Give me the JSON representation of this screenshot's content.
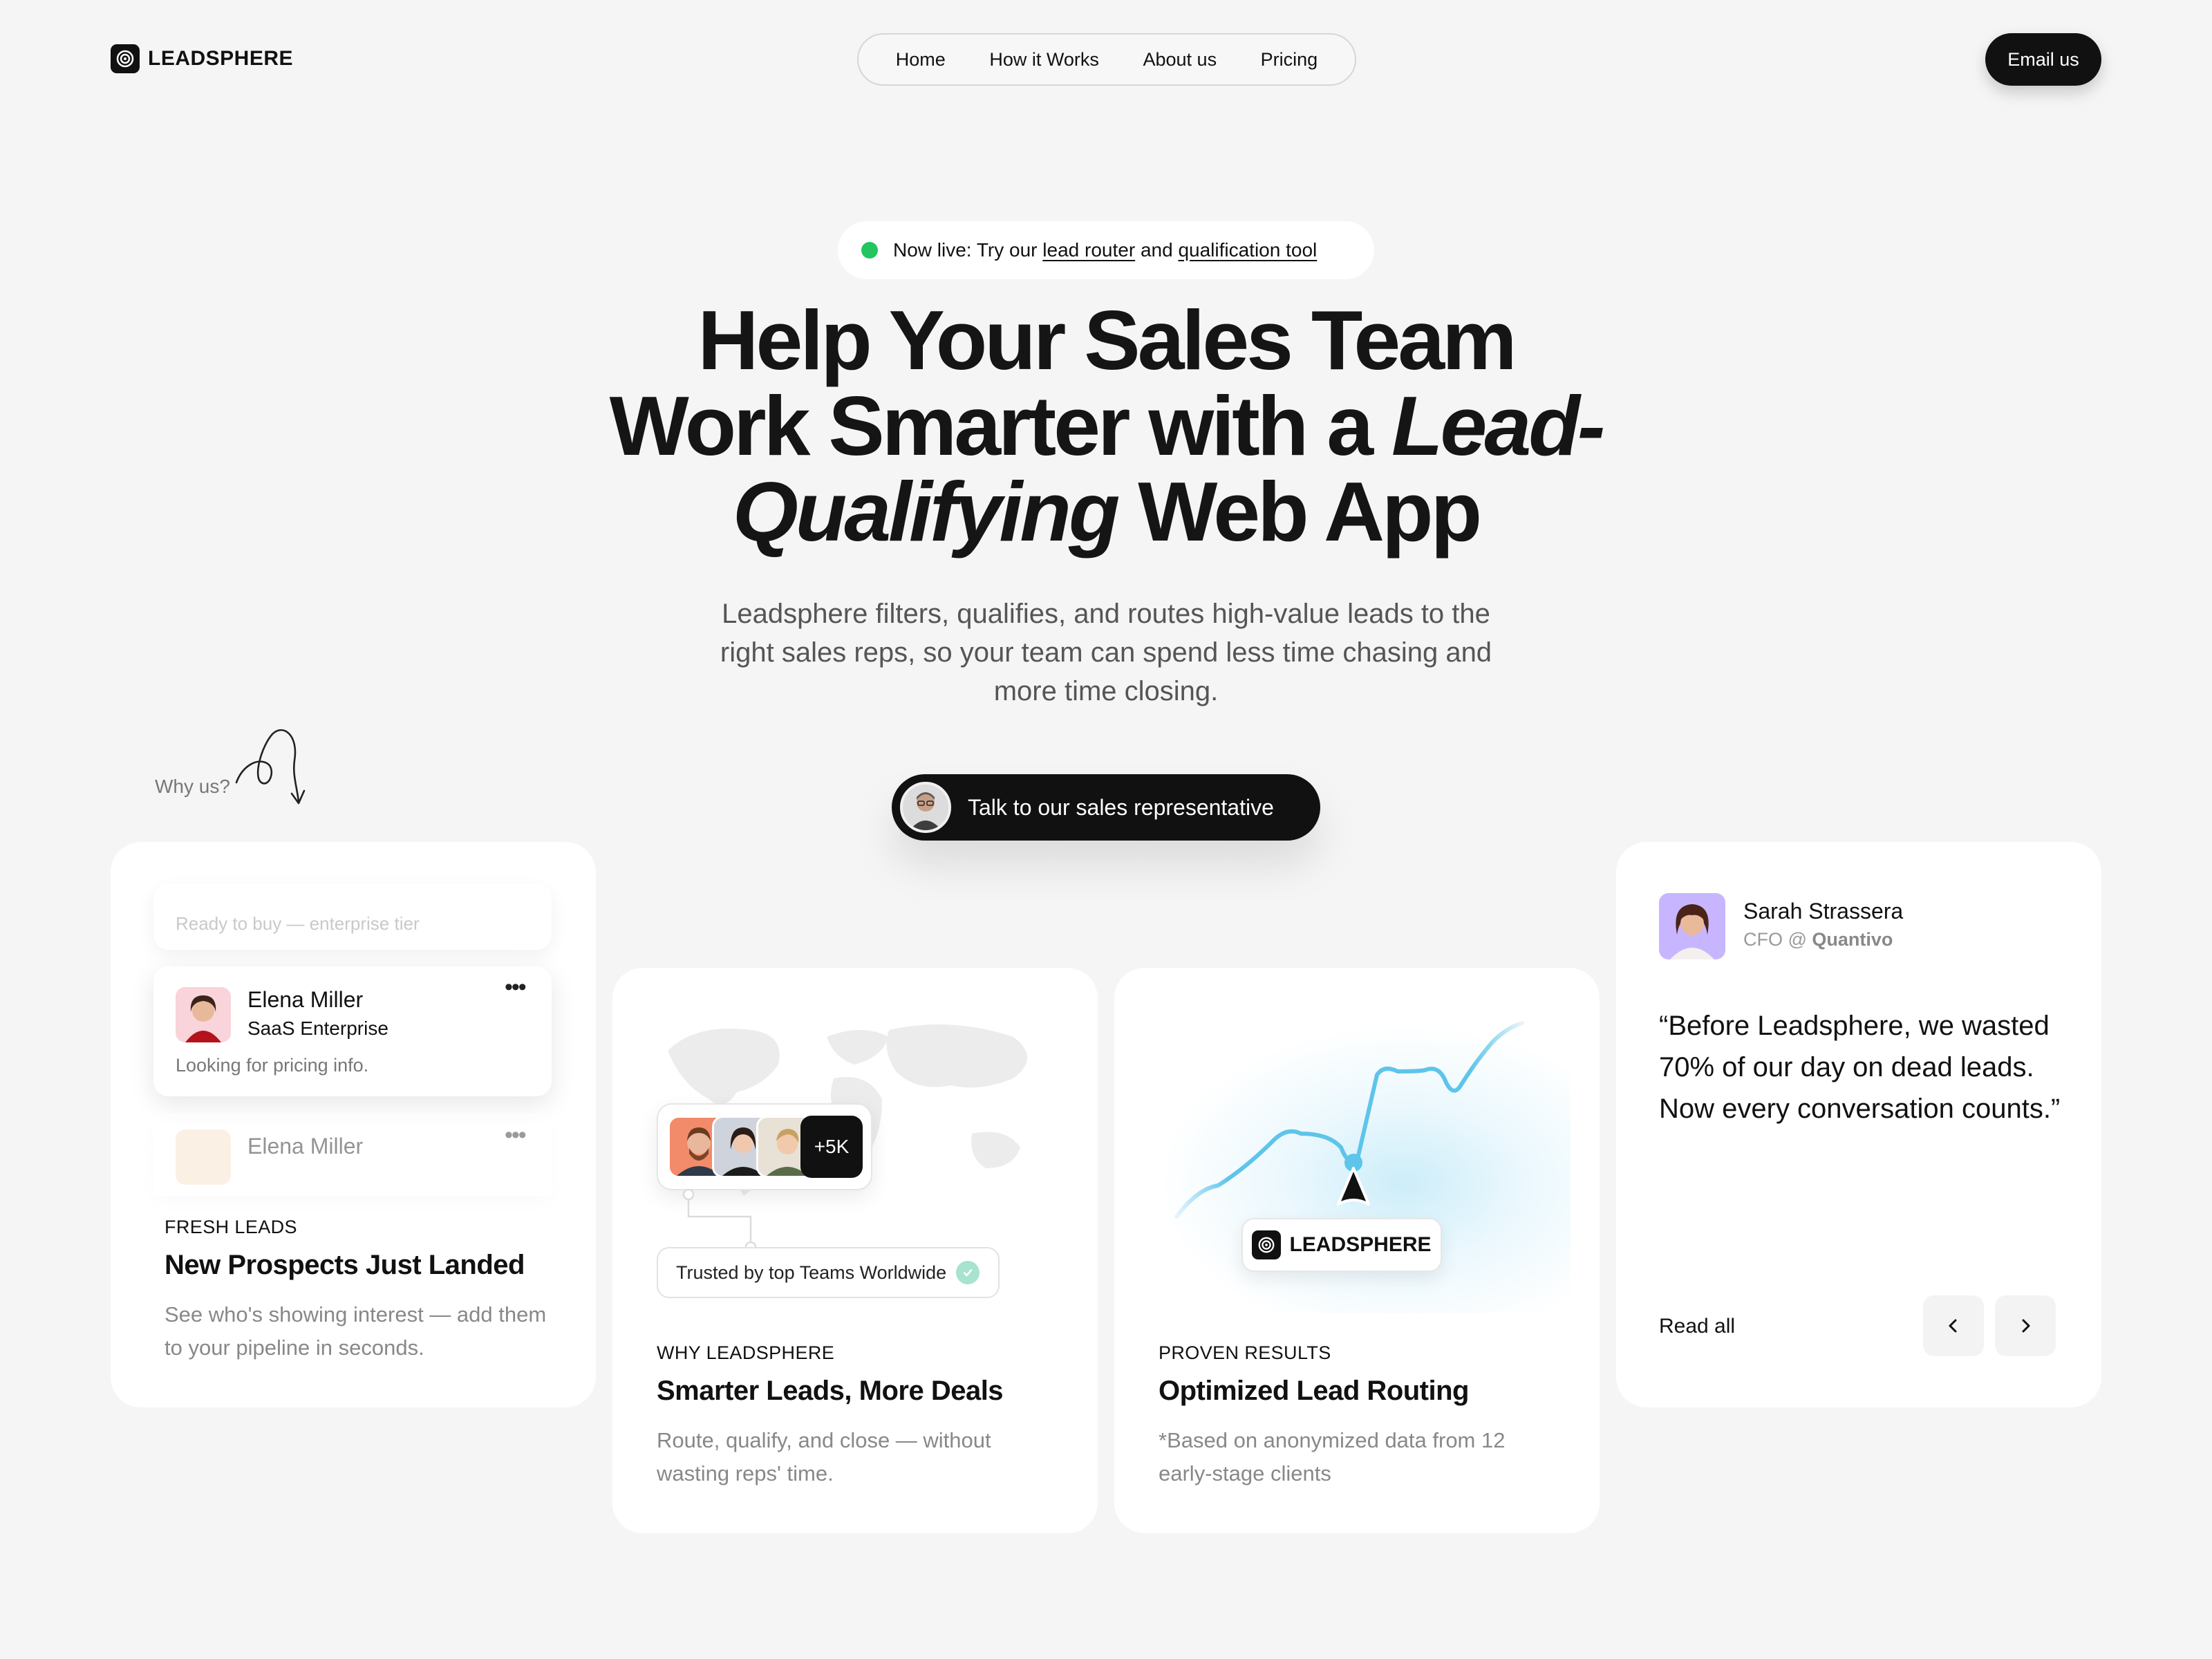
{
  "brand": {
    "name": "LEADSPHERE"
  },
  "nav": {
    "items": [
      "Home",
      "How it Works",
      "About us",
      "Pricing"
    ]
  },
  "header": {
    "email_label": "Email us"
  },
  "hero": {
    "live_prefix": "Now live: Try our",
    "live_link1": "lead router",
    "live_and": "and",
    "live_link2": "qualification tool",
    "title_line1": "Help Your Sales Team",
    "title_line2_a": "Work Smarter with a ",
    "title_line2_b": "Lead-",
    "title_line3_a": "Qualifying",
    "title_line3_b": " Web App",
    "subtitle": "Leadsphere filters, qualifies, and routes high-value leads to the right sales reps, so your team can spend less time chasing and more time closing.",
    "cta_label": "Talk to our sales representative",
    "why_us": "Why us?"
  },
  "cards": {
    "fresh": {
      "ghost_text": "Ready to buy — enterprise tier",
      "lead_name": "Elena Miller",
      "lead_company": "SaaS Enterprise",
      "lead_note": "Looking for pricing info.",
      "faded_name": "Elena Miller",
      "eyebrow": "FRESH LEADS",
      "title": "New Prospects Just Landed",
      "desc": "See who's showing interest — add them to your pipeline in seconds."
    },
    "why": {
      "more_count": "+5K",
      "trusted": "Trusted by top Teams Worldwide",
      "eyebrow": "WHY LEADSPHERE",
      "title": "Smarter Leads, More Deals",
      "desc": "Route, qualify, and close — without wasting reps' time."
    },
    "results": {
      "chip_label": "LEADSPHERE",
      "eyebrow": "PROVEN RESULTS",
      "title": "Optimized Lead Routing",
      "desc": "*Based on anonymized data from 12 early-stage clients"
    },
    "testimonial": {
      "name": "Sarah Strassera",
      "role_prefix": "CFO @",
      "company": "Quantivo",
      "quote": "“Before Leadsphere, we wasted 70% of our day on dead leads. Now every conversation counts.”",
      "read_all": "Read all"
    }
  },
  "colors": {
    "background": "#f5f5f5",
    "primary": "#111111",
    "live_dot": "#22c55e",
    "chart_line": "#5ec4ea",
    "check": "#a7e3cf"
  },
  "icons": [
    "logo-icon",
    "arrow-doodle-icon",
    "more-dots-icon",
    "check-icon",
    "location-pin-icon",
    "chevron-left-icon",
    "chevron-right-icon",
    "world-map-icon"
  ]
}
